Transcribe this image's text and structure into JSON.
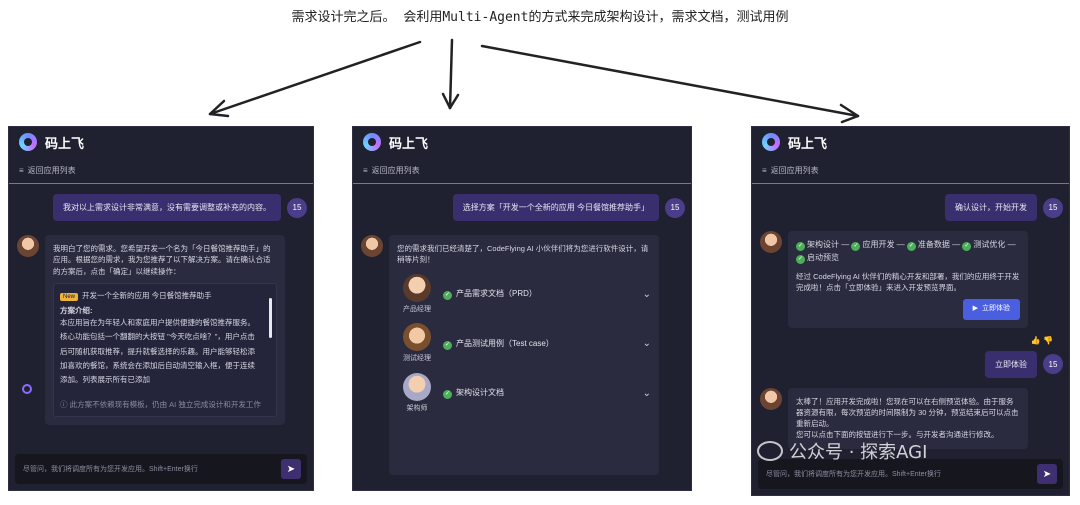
{
  "caption": "需求设计完之后。 会利用Multi-Agent的方式来完成架构设计，需求文档，测试用例",
  "app_name": "码上飞",
  "back_link": "返回应用列表",
  "input_placeholder": "尽管问，我们将调度所有为您开发应用。Shift+Enter换行",
  "avatar_label": "15",
  "panel1": {
    "user_message": "我对以上需求设计非常满意，没有需要调整或补充的内容。",
    "ai_message": "我明白了您的需求。您希望开发一个名为「今日餐馆推荐助手」的应用。根据您的需求，我为您推荐了以下解决方案。请在确认合适的方案后，点击「确定」以继续操作：",
    "new_badge": "New",
    "plan_title": "开发一个全新的应用 今日餐馆推荐助手",
    "plan_intro_label": "方案介绍:",
    "plan_text": "本应用旨在为年轻人和家庭用户提供便捷的餐馆推荐服务。核心功能包括一个翻翻的大按钮 \"今天吃点啥？\"，用户点击后可随机获取推荐，提升就餐选择的乐趣。用户能够轻松添加喜欢的餐馆，系统会在添加后自动清空输入框，便于连续添加。列表展示所有已添加",
    "plan_note": "此方案不依赖现有模板，仍由 AI 独立完成设计和开发工作"
  },
  "panel2": {
    "user_message": "选择方案「开发一个全新的应用 今日餐馆推荐助手」",
    "ai_message": "您的需求我们已经清楚了，CodeFlying AI 小伙伴们将为您进行软件设计，请稍等片刻！",
    "roles": [
      {
        "name": "产品经理",
        "doc": "产品需求文档（PRD）"
      },
      {
        "name": "测试经理",
        "doc": "产品测试用例（Test case）"
      },
      {
        "name": "架构师",
        "doc": "架构设计文档"
      }
    ]
  },
  "panel3": {
    "user_message": "确认设计，开始开发",
    "steps": [
      "架构设计",
      "应用开发",
      "准备数据",
      "测试优化",
      "启动预览"
    ],
    "ai_message": "经过 CodeFlying AI 伙伴们的精心开发和部署，我们的应用终于开发完成啦！点击「立即体验」来进入开发预览界面。",
    "try_button": "立即体验",
    "user_message2": "立即体验",
    "ai_message2": "太棒了！应用开发完成啦！您现在可以在右侧预览体验。由于服务器资源有限，每次预览的时间限制为 30 分钟，预览结束后可以点击重新启动。",
    "ai_message2_tail": "您可以点击下面的按钮进行下一步。与开发者沟通进行修改。"
  },
  "watermark": "公众号 · 探索AGI",
  "colors": {
    "panel_bg": "#1f2030",
    "accent": "#4e7fd0",
    "user_bubble": "#3a2f6e",
    "check": "#4cb05a",
    "button": "#4a5ee0"
  }
}
